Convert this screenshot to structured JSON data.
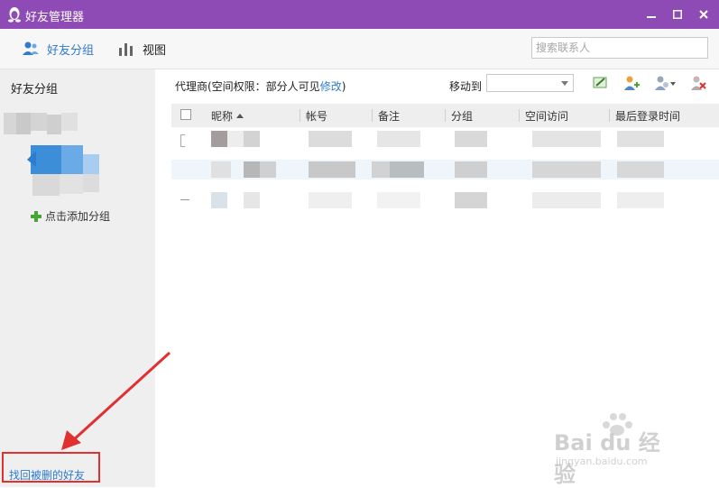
{
  "window": {
    "title": "好友管理器",
    "accent": "#8e4bb5"
  },
  "toolbar": {
    "groups_label": "好友分组",
    "view_label": "视图",
    "search_placeholder": "搜索联系人"
  },
  "sidebar": {
    "header": "好友分组",
    "add_group": "点击添加分组",
    "recover_link": "找回被删的好友"
  },
  "main": {
    "permission_prefix": "代理商(空间权限：部分人可见",
    "permission_link": "修改",
    "permission_suffix": ")",
    "move_to_label": "移动到",
    "columns": [
      "昵称",
      "帐号",
      "备注",
      "分组",
      "空间访问",
      "最后登录时间"
    ]
  },
  "watermark": {
    "text": "Bai du 经验",
    "url": "jingyan.baidu.com"
  },
  "colors": {
    "link": "#2d7cd0",
    "highlight_border": "#e03030",
    "arrow": "#e03030"
  }
}
